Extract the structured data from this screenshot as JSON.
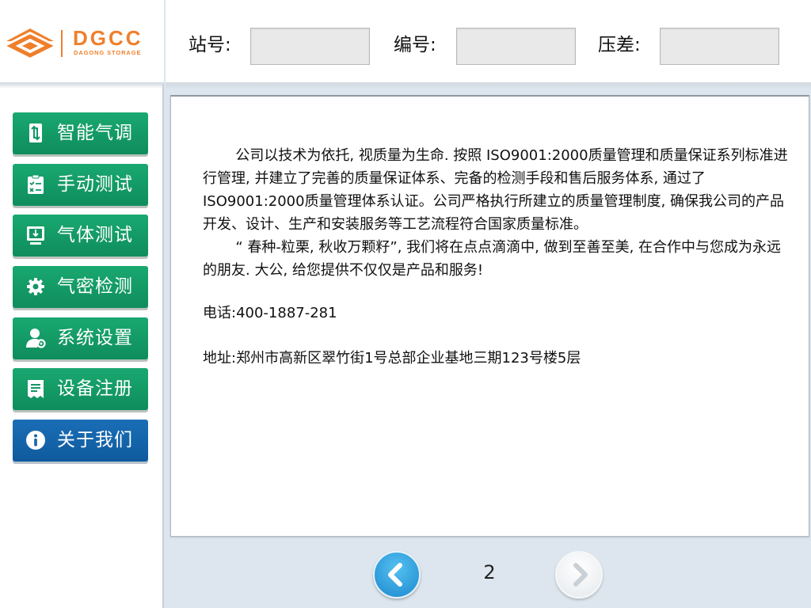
{
  "brand": {
    "name": "DGCC",
    "tagline": "DAGONG STORAGE",
    "accent_color": "#ef7f2b"
  },
  "header": {
    "fields": [
      {
        "label": "站号:",
        "value": ""
      },
      {
        "label": "编号:",
        "value": ""
      },
      {
        "label": "压差:",
        "value": ""
      }
    ]
  },
  "sidebar": {
    "items": [
      {
        "label": "智能气调",
        "icon": "phone-transfer-icon",
        "active": false
      },
      {
        "label": "手动测试",
        "icon": "clipboard-checklist-icon",
        "active": false
      },
      {
        "label": "气体测试",
        "icon": "monitor-download-icon",
        "active": false
      },
      {
        "label": "气密检测",
        "icon": "gear-icon",
        "active": false
      },
      {
        "label": "系统设置",
        "icon": "user-settings-icon",
        "active": false
      },
      {
        "label": "设备注册",
        "icon": "register-document-icon",
        "active": false
      },
      {
        "label": "关于我们",
        "icon": "info-icon",
        "active": true
      }
    ],
    "colors": {
      "normal": "#139666",
      "active": "#1565ab"
    }
  },
  "content": {
    "paragraphs": [
      "公司以技术为依托, 视质量为生命. 按照 ISO9001:2000质量管理和质量保证系列标准进行管理, 并建立了完善的质量保证体系、完备的检测手段和售后服务体系, 通过了 ISO9001:2000质量管理体系认证。公司严格执行所建立的质量管理制度, 确保我公司的产品开发、设计、生产和安装服务等工艺流程符合国家质量标准。",
      "“ 春种-粒栗, 秋收万颗籽”, 我们将在点点滴滴中, 做到至善至美, 在合作中与您成为永远的朋友. 大公, 给您提供不仅仅是产品和服务!"
    ],
    "phone": "电话:400-1887-281",
    "address": "地址:郑州市高新区翠竹街1号总部企业基地三期123号楼5层"
  },
  "pagination": {
    "current_page": "2",
    "prev_icon": "chevron-left-icon",
    "next_icon": "chevron-right-icon"
  }
}
